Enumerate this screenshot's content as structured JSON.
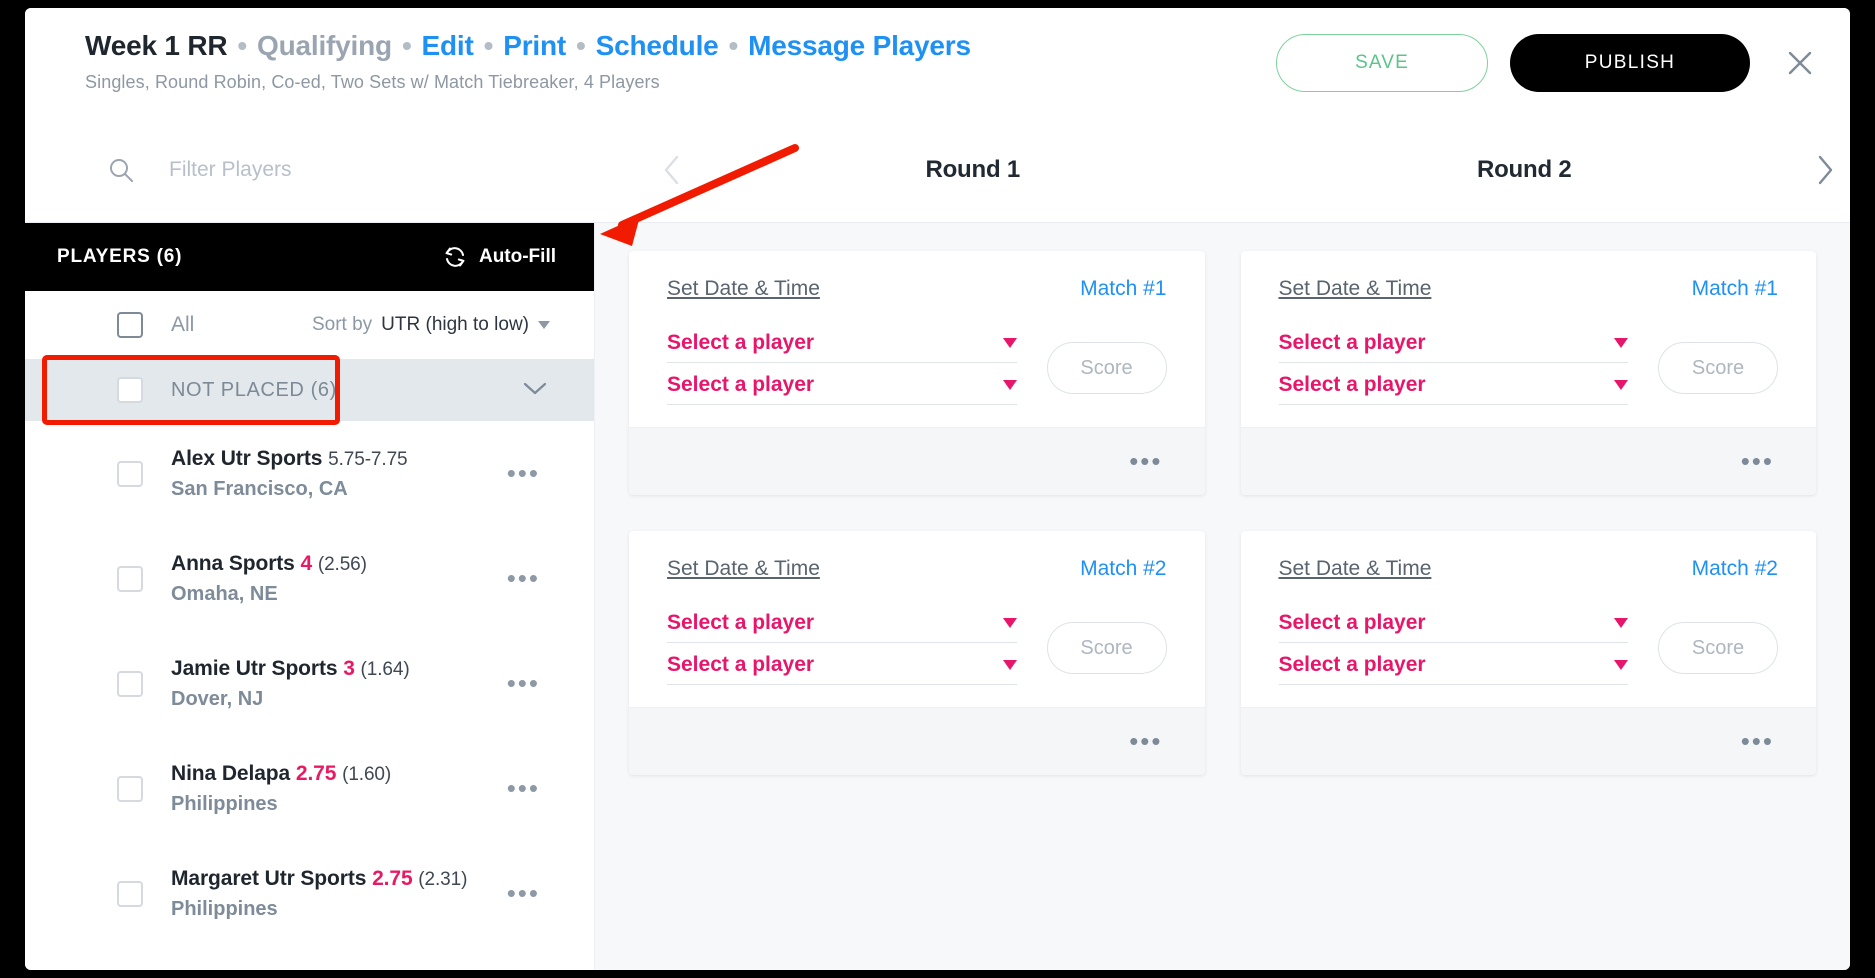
{
  "header": {
    "event_name": "Week 1 RR",
    "stage": "Qualifying",
    "links": [
      "Edit",
      "Print",
      "Schedule",
      "Message Players"
    ],
    "separator": "•",
    "subtitle": "Singles, Round Robin, Co-ed, Two Sets w/ Match Tiebreaker, 4 Players",
    "save_label": "SAVE",
    "publish_label": "PUBLISH",
    "close_icon": "close-icon"
  },
  "toolbar": {
    "search_placeholder": "Filter Players",
    "search_value": "",
    "search_icon": "search-icon",
    "prev_icon": "chevron-left-icon",
    "next_icon": "chevron-right-icon"
  },
  "sidebar": {
    "players_header": "PLAYERS (6)",
    "autofill_label": "Auto-Fill",
    "autofill_icon": "refresh-sync-icon",
    "all_label": "All",
    "sort_prefix": "Sort by",
    "sort_value": "UTR (high to low)",
    "group_label": "NOT PLACED (6)",
    "group_chevron": "chevron-down-icon",
    "overflow_icon": "ellipsis-icon",
    "players": [
      {
        "name": "Alex Utr Sports",
        "rating": "5.75-7.75",
        "rating_type": "range",
        "reliability": "",
        "location": "San Francisco, CA"
      },
      {
        "name": "Anna Sports",
        "rating": "4",
        "rating_type": "value",
        "reliability": "(2.56)",
        "location": "Omaha, NE"
      },
      {
        "name": "Jamie Utr Sports",
        "rating": "3",
        "rating_type": "value",
        "reliability": "(1.64)",
        "location": "Dover, NJ"
      },
      {
        "name": "Nina Delapa",
        "rating": "2.75",
        "rating_type": "value",
        "reliability": "(1.60)",
        "location": "Philippines"
      },
      {
        "name": "Margaret Utr Sports",
        "rating": "2.75",
        "rating_type": "value",
        "reliability": "(2.31)",
        "location": "Philippines"
      }
    ]
  },
  "rounds": [
    {
      "title": "Round 1",
      "matches": [
        {
          "set_date_time": "Set Date & Time",
          "match_label": "Match #1",
          "player1": "Select a player",
          "player2": "Select a player",
          "score_label": "Score",
          "overflow": "•••"
        },
        {
          "set_date_time": "Set Date & Time",
          "match_label": "Match #2",
          "player1": "Select a player",
          "player2": "Select a player",
          "score_label": "Score",
          "overflow": "•••"
        }
      ]
    },
    {
      "title": "Round 2",
      "matches": [
        {
          "set_date_time": "Set Date & Time",
          "match_label": "Match #1",
          "player1": "Select a player",
          "player2": "Select a player",
          "score_label": "Score",
          "overflow": "•••"
        },
        {
          "set_date_time": "Set Date & Time",
          "match_label": "Match #2",
          "player1": "Select a player",
          "player2": "Select a player",
          "score_label": "Score",
          "overflow": "•••"
        }
      ]
    }
  ],
  "annotations": {
    "arrow_color": "#f01b00",
    "highlight_color": "#f01b00",
    "arrow_target": "autofill-button",
    "highlight_target": "not-placed-group-row"
  },
  "colors": {
    "accent_pink": "#e8166a",
    "link_blue": "#1f91f3",
    "save_green": "#5cc489",
    "publish_black": "#000000"
  }
}
